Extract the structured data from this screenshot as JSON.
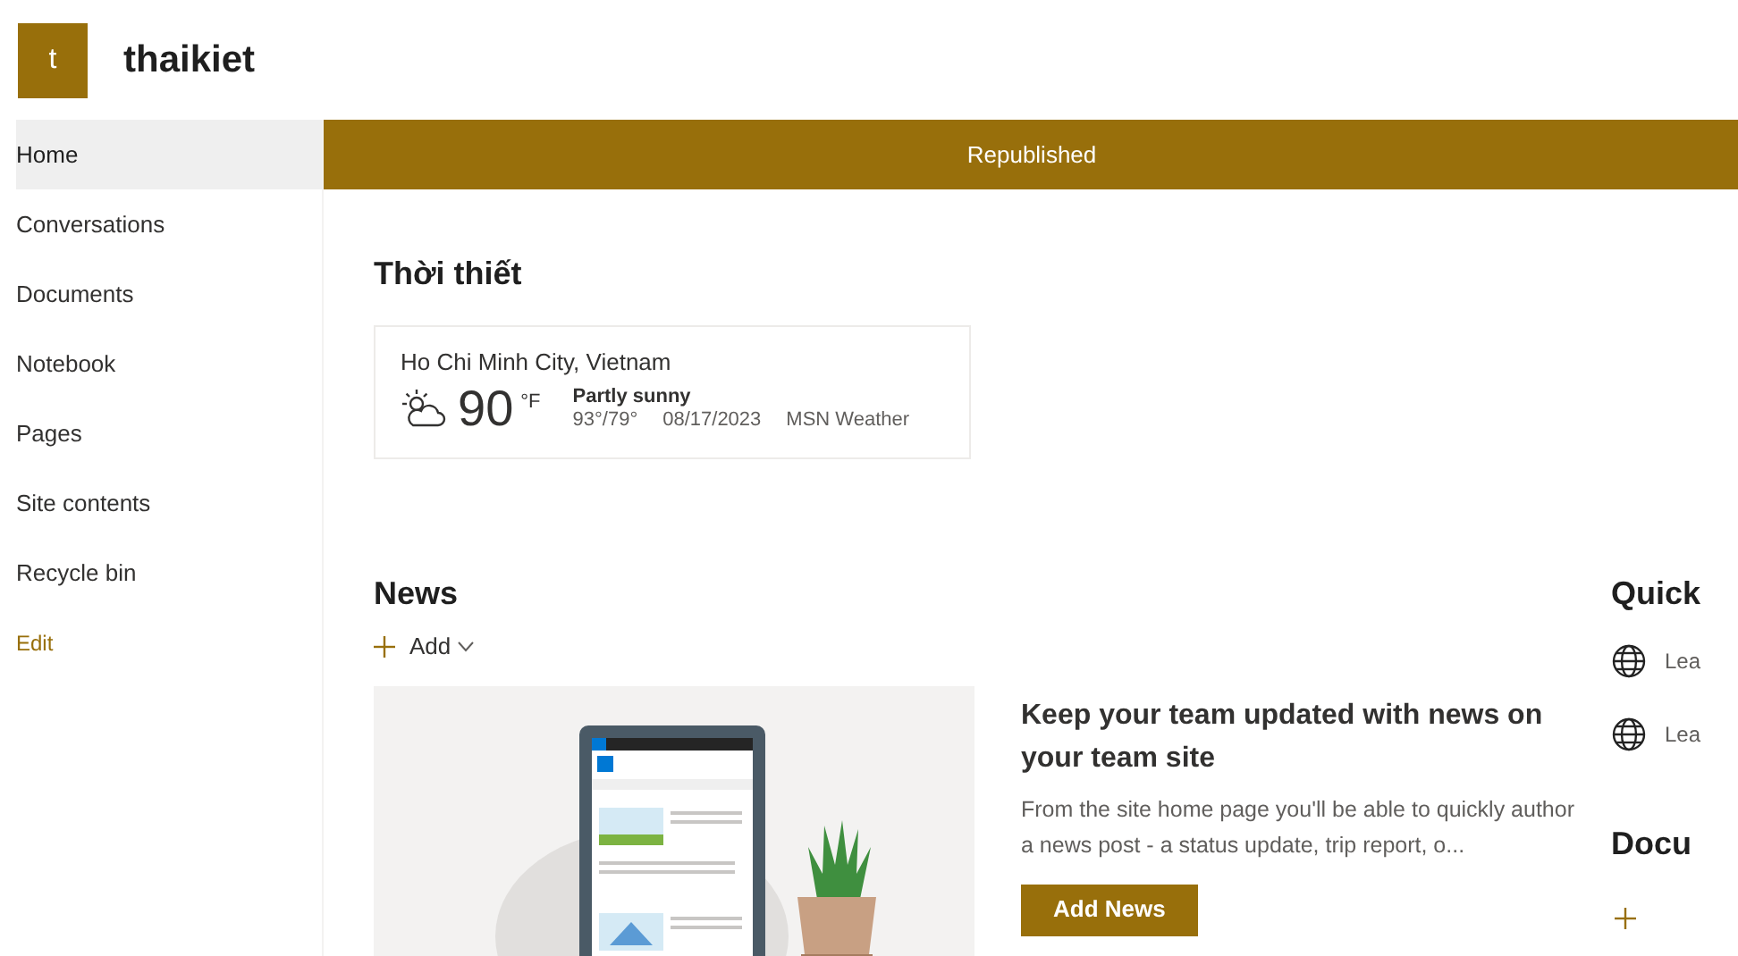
{
  "site": {
    "logo_letter": "t",
    "title": "thaikiet"
  },
  "nav": {
    "items": [
      {
        "label": "Home",
        "selected": true
      },
      {
        "label": "Conversations",
        "selected": false
      },
      {
        "label": "Documents",
        "selected": false
      },
      {
        "label": "Notebook",
        "selected": false
      },
      {
        "label": "Pages",
        "selected": false
      },
      {
        "label": "Site contents",
        "selected": false
      },
      {
        "label": "Recycle bin",
        "selected": false
      }
    ],
    "edit": "Edit"
  },
  "banner": "Republished",
  "weather": {
    "heading": "Thời thiết",
    "location": "Ho Chi Minh City, Vietnam",
    "temperature": "90",
    "unit": "°F",
    "condition": "Partly sunny",
    "range": "93°/79°",
    "date": "08/17/2023",
    "source": "MSN Weather"
  },
  "news": {
    "heading": "News",
    "add": "Add",
    "card": {
      "title": "Keep your team updated with news on your team site",
      "description": "From the site home page you'll be able to quickly author a news post - a status update, trip report, o...",
      "button": "Add News"
    }
  },
  "quick_links": {
    "heading": "Quick",
    "items": [
      "Lea",
      "Lea"
    ]
  },
  "documents": {
    "heading": "Docu"
  }
}
